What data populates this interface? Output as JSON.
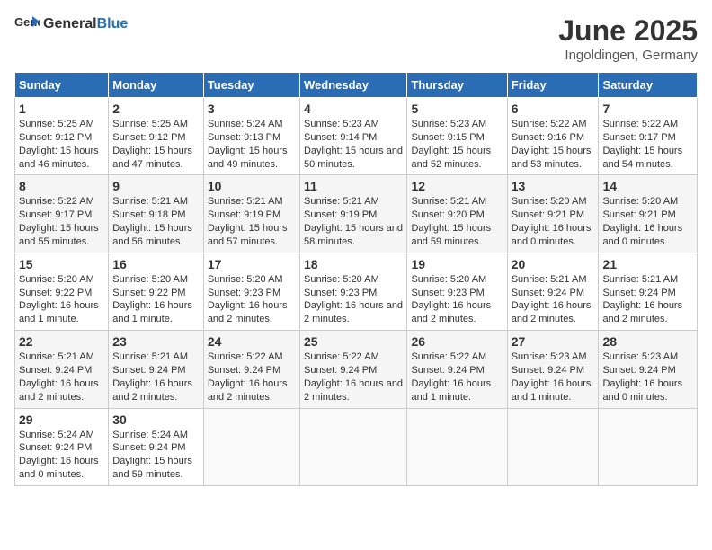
{
  "header": {
    "logo_general": "General",
    "logo_blue": "Blue",
    "title": "June 2025",
    "subtitle": "Ingoldingen, Germany"
  },
  "columns": [
    "Sunday",
    "Monday",
    "Tuesday",
    "Wednesday",
    "Thursday",
    "Friday",
    "Saturday"
  ],
  "weeks": [
    [
      {
        "day": "1",
        "sunrise": "Sunrise: 5:25 AM",
        "sunset": "Sunset: 9:12 PM",
        "daylight": "Daylight: 15 hours and 46 minutes."
      },
      {
        "day": "2",
        "sunrise": "Sunrise: 5:25 AM",
        "sunset": "Sunset: 9:12 PM",
        "daylight": "Daylight: 15 hours and 47 minutes."
      },
      {
        "day": "3",
        "sunrise": "Sunrise: 5:24 AM",
        "sunset": "Sunset: 9:13 PM",
        "daylight": "Daylight: 15 hours and 49 minutes."
      },
      {
        "day": "4",
        "sunrise": "Sunrise: 5:23 AM",
        "sunset": "Sunset: 9:14 PM",
        "daylight": "Daylight: 15 hours and 50 minutes."
      },
      {
        "day": "5",
        "sunrise": "Sunrise: 5:23 AM",
        "sunset": "Sunset: 9:15 PM",
        "daylight": "Daylight: 15 hours and 52 minutes."
      },
      {
        "day": "6",
        "sunrise": "Sunrise: 5:22 AM",
        "sunset": "Sunset: 9:16 PM",
        "daylight": "Daylight: 15 hours and 53 minutes."
      },
      {
        "day": "7",
        "sunrise": "Sunrise: 5:22 AM",
        "sunset": "Sunset: 9:17 PM",
        "daylight": "Daylight: 15 hours and 54 minutes."
      }
    ],
    [
      {
        "day": "8",
        "sunrise": "Sunrise: 5:22 AM",
        "sunset": "Sunset: 9:17 PM",
        "daylight": "Daylight: 15 hours and 55 minutes."
      },
      {
        "day": "9",
        "sunrise": "Sunrise: 5:21 AM",
        "sunset": "Sunset: 9:18 PM",
        "daylight": "Daylight: 15 hours and 56 minutes."
      },
      {
        "day": "10",
        "sunrise": "Sunrise: 5:21 AM",
        "sunset": "Sunset: 9:19 PM",
        "daylight": "Daylight: 15 hours and 57 minutes."
      },
      {
        "day": "11",
        "sunrise": "Sunrise: 5:21 AM",
        "sunset": "Sunset: 9:19 PM",
        "daylight": "Daylight: 15 hours and 58 minutes."
      },
      {
        "day": "12",
        "sunrise": "Sunrise: 5:21 AM",
        "sunset": "Sunset: 9:20 PM",
        "daylight": "Daylight: 15 hours and 59 minutes."
      },
      {
        "day": "13",
        "sunrise": "Sunrise: 5:20 AM",
        "sunset": "Sunset: 9:21 PM",
        "daylight": "Daylight: 16 hours and 0 minutes."
      },
      {
        "day": "14",
        "sunrise": "Sunrise: 5:20 AM",
        "sunset": "Sunset: 9:21 PM",
        "daylight": "Daylight: 16 hours and 0 minutes."
      }
    ],
    [
      {
        "day": "15",
        "sunrise": "Sunrise: 5:20 AM",
        "sunset": "Sunset: 9:22 PM",
        "daylight": "Daylight: 16 hours and 1 minute."
      },
      {
        "day": "16",
        "sunrise": "Sunrise: 5:20 AM",
        "sunset": "Sunset: 9:22 PM",
        "daylight": "Daylight: 16 hours and 1 minute."
      },
      {
        "day": "17",
        "sunrise": "Sunrise: 5:20 AM",
        "sunset": "Sunset: 9:23 PM",
        "daylight": "Daylight: 16 hours and 2 minutes."
      },
      {
        "day": "18",
        "sunrise": "Sunrise: 5:20 AM",
        "sunset": "Sunset: 9:23 PM",
        "daylight": "Daylight: 16 hours and 2 minutes."
      },
      {
        "day": "19",
        "sunrise": "Sunrise: 5:20 AM",
        "sunset": "Sunset: 9:23 PM",
        "daylight": "Daylight: 16 hours and 2 minutes."
      },
      {
        "day": "20",
        "sunrise": "Sunrise: 5:21 AM",
        "sunset": "Sunset: 9:24 PM",
        "daylight": "Daylight: 16 hours and 2 minutes."
      },
      {
        "day": "21",
        "sunrise": "Sunrise: 5:21 AM",
        "sunset": "Sunset: 9:24 PM",
        "daylight": "Daylight: 16 hours and 2 minutes."
      }
    ],
    [
      {
        "day": "22",
        "sunrise": "Sunrise: 5:21 AM",
        "sunset": "Sunset: 9:24 PM",
        "daylight": "Daylight: 16 hours and 2 minutes."
      },
      {
        "day": "23",
        "sunrise": "Sunrise: 5:21 AM",
        "sunset": "Sunset: 9:24 PM",
        "daylight": "Daylight: 16 hours and 2 minutes."
      },
      {
        "day": "24",
        "sunrise": "Sunrise: 5:22 AM",
        "sunset": "Sunset: 9:24 PM",
        "daylight": "Daylight: 16 hours and 2 minutes."
      },
      {
        "day": "25",
        "sunrise": "Sunrise: 5:22 AM",
        "sunset": "Sunset: 9:24 PM",
        "daylight": "Daylight: 16 hours and 2 minutes."
      },
      {
        "day": "26",
        "sunrise": "Sunrise: 5:22 AM",
        "sunset": "Sunset: 9:24 PM",
        "daylight": "Daylight: 16 hours and 1 minute."
      },
      {
        "day": "27",
        "sunrise": "Sunrise: 5:23 AM",
        "sunset": "Sunset: 9:24 PM",
        "daylight": "Daylight: 16 hours and 1 minute."
      },
      {
        "day": "28",
        "sunrise": "Sunrise: 5:23 AM",
        "sunset": "Sunset: 9:24 PM",
        "daylight": "Daylight: 16 hours and 0 minutes."
      }
    ],
    [
      {
        "day": "29",
        "sunrise": "Sunrise: 5:24 AM",
        "sunset": "Sunset: 9:24 PM",
        "daylight": "Daylight: 16 hours and 0 minutes."
      },
      {
        "day": "30",
        "sunrise": "Sunrise: 5:24 AM",
        "sunset": "Sunset: 9:24 PM",
        "daylight": "Daylight: 15 hours and 59 minutes."
      },
      null,
      null,
      null,
      null,
      null
    ]
  ]
}
